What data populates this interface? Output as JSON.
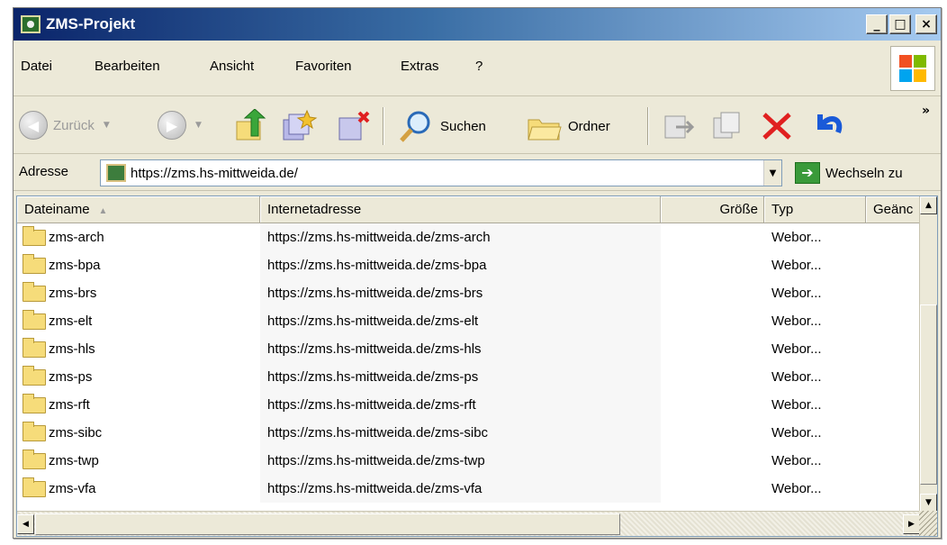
{
  "window": {
    "title": "ZMS-Projekt",
    "controls": {
      "minimize": "_",
      "maximize": "□",
      "close": "×"
    }
  },
  "menu": {
    "items": [
      {
        "label": "Datei"
      },
      {
        "label": "Bearbeiten"
      },
      {
        "label": "Ansicht"
      },
      {
        "label": "Favoriten"
      },
      {
        "label": "Extras"
      },
      {
        "label": "?"
      }
    ]
  },
  "toolbar": {
    "back_label": "Zurück",
    "search_label": "Suchen",
    "folders_label": "Ordner",
    "more_glyph": "»"
  },
  "address": {
    "label": "Adresse",
    "value": "https://zms.hs-mittweida.de/",
    "go_label": "Wechseln zu"
  },
  "list": {
    "columns": [
      "Dateiname",
      "Internetadresse",
      "Größe",
      "Typ",
      "Geänc"
    ],
    "rows": [
      {
        "name": "zms-arch",
        "url": "https://zms.hs-mittweida.de/zms-arch",
        "size": "",
        "type": "Webor..."
      },
      {
        "name": "zms-bpa",
        "url": "https://zms.hs-mittweida.de/zms-bpa",
        "size": "",
        "type": "Webor..."
      },
      {
        "name": "zms-brs",
        "url": "https://zms.hs-mittweida.de/zms-brs",
        "size": "",
        "type": "Webor..."
      },
      {
        "name": "zms-elt",
        "url": "https://zms.hs-mittweida.de/zms-elt",
        "size": "",
        "type": "Webor..."
      },
      {
        "name": "zms-hls",
        "url": "https://zms.hs-mittweida.de/zms-hls",
        "size": "",
        "type": "Webor..."
      },
      {
        "name": "zms-ps",
        "url": "https://zms.hs-mittweida.de/zms-ps",
        "size": "",
        "type": "Webor..."
      },
      {
        "name": "zms-rft",
        "url": "https://zms.hs-mittweida.de/zms-rft",
        "size": "",
        "type": "Webor..."
      },
      {
        "name": "zms-sibc",
        "url": "https://zms.hs-mittweida.de/zms-sibc",
        "size": "",
        "type": "Webor..."
      },
      {
        "name": "zms-twp",
        "url": "https://zms.hs-mittweida.de/zms-twp",
        "size": "",
        "type": "Webor..."
      },
      {
        "name": "zms-vfa",
        "url": "https://zms.hs-mittweida.de/zms-vfa",
        "size": "",
        "type": "Webor..."
      }
    ]
  },
  "colors": {
    "title_gradient_start": "#0a246a",
    "title_gradient_end": "#a6caf0",
    "chrome": "#ece9d8",
    "stop_red": "#e02020",
    "go_green": "#3a9a3a"
  },
  "icons": {
    "folder": "folder-icon",
    "back": "back-arrow-icon",
    "forward": "forward-arrow-icon",
    "up": "folder-up-icon",
    "search": "search-icon",
    "folders": "folders-icon",
    "stop": "stop-icon",
    "undo": "undo-icon"
  }
}
